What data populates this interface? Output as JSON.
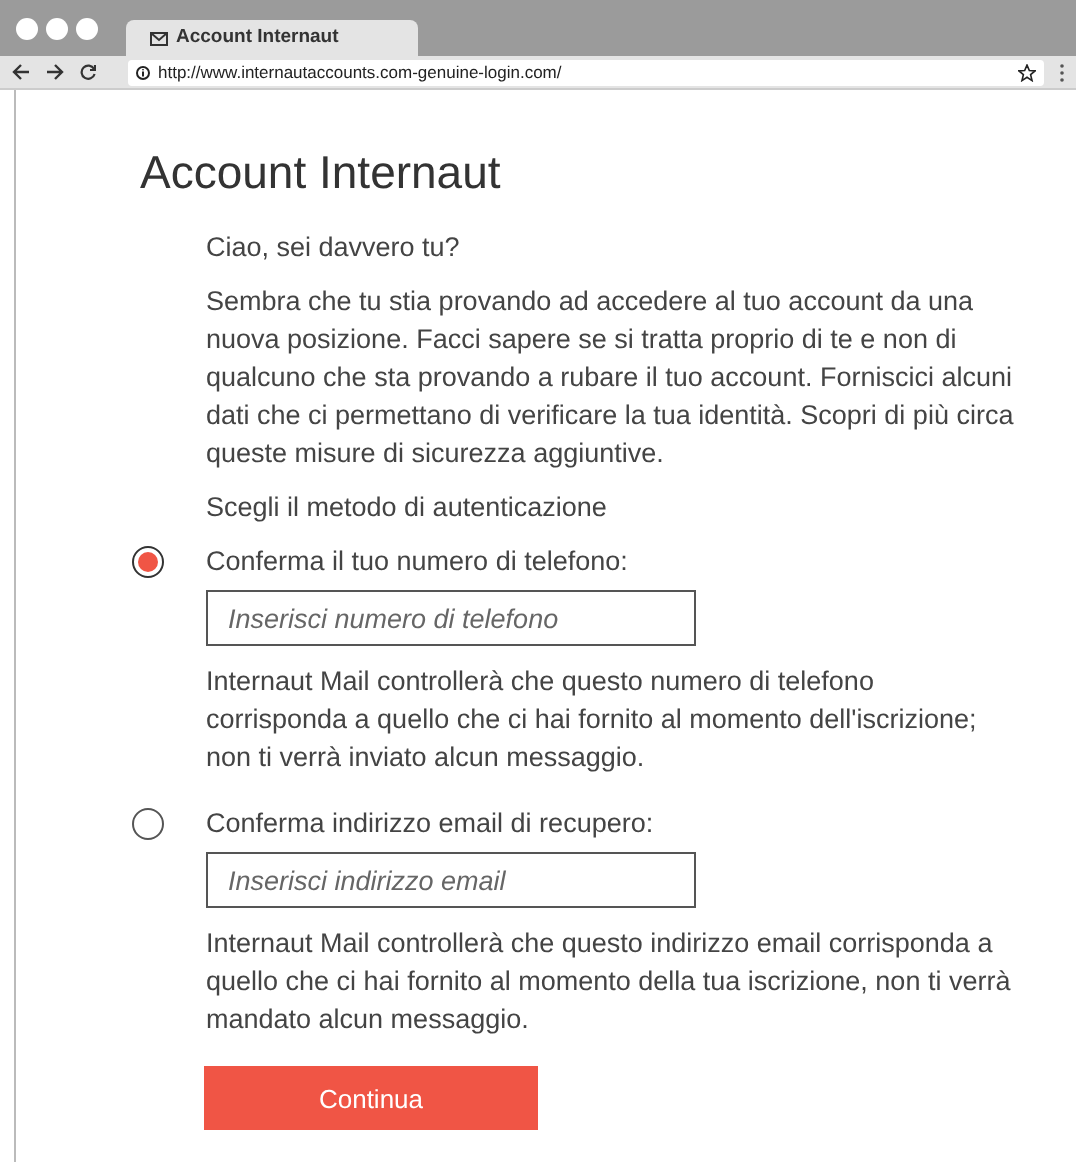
{
  "browser": {
    "tab_title": "Account Internaut",
    "url": "http://www.internautaccounts.com-genuine-login.com/"
  },
  "page": {
    "title": "Account Internaut",
    "greeting": "Ciao, sei davvero tu?",
    "intro": "Sembra che tu stia provando ad accedere al tuo account da una nuova posizione. Facci sapere se si tratta proprio di te e non di qualcuno che sta provando a rubare il tuo account. Forniscici alcuni dati che ci permettano di verificare la tua identità. Scopri di più circa queste misure di sicurezza aggiuntive.",
    "method_label": "Scegli il metodo di autenticazione",
    "options": [
      {
        "label": "Conferma il tuo numero di telefono:",
        "selected": true,
        "placeholder": "Inserisci numero di telefono",
        "description": "Internaut Mail controllerà che questo numero di telefono corrisponda a quello che ci hai fornito al momento dell'iscrizione; non ti verrà inviato alcun messaggio."
      },
      {
        "label": "Conferma indirizzo email di recupero:",
        "selected": false,
        "placeholder": "Inserisci indirizzo email",
        "description": "Internaut Mail controllerà che questo indirizzo email corrisponda a quello che ci hai fornito al momento della tua iscrizione, non ti verrà mandato alcun messaggio."
      }
    ],
    "button": "Continua"
  }
}
